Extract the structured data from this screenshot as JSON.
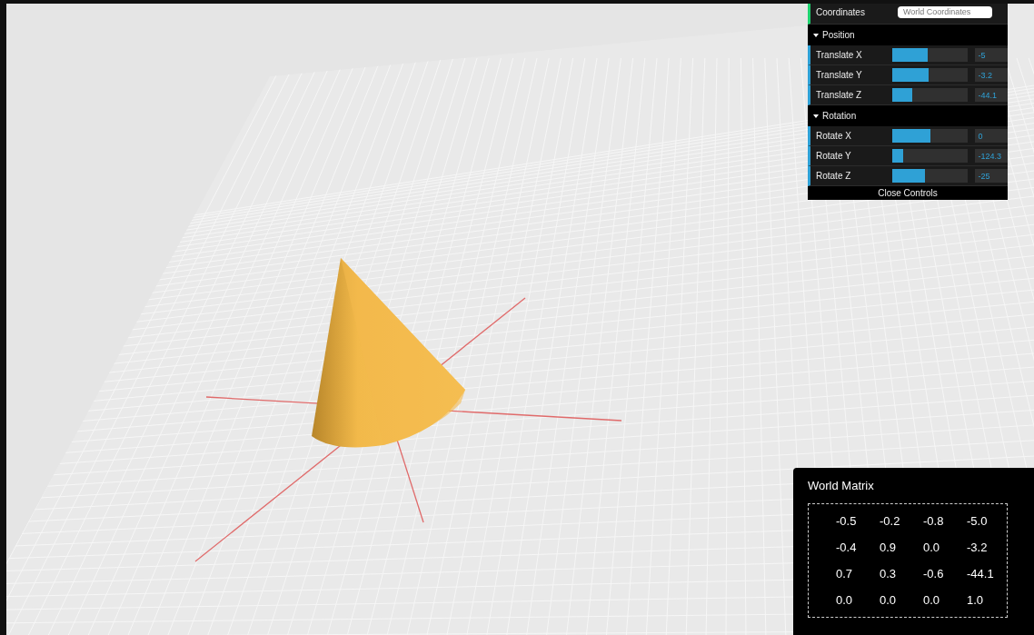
{
  "controls": {
    "coordinates": {
      "label": "Coordinates",
      "value": "World Coordinates"
    },
    "folders": [
      {
        "title": "Position",
        "expanded": true,
        "rows": [
          {
            "label": "Translate X",
            "level": 0.47,
            "value": "-5"
          },
          {
            "label": "Translate Y",
            "level": 0.48,
            "value": "-3.2"
          },
          {
            "label": "Translate Z",
            "level": 0.27,
            "value": "-44.1"
          }
        ]
      },
      {
        "title": "Rotation",
        "expanded": true,
        "rows": [
          {
            "label": "Rotate X",
            "level": 0.5,
            "value": "0"
          },
          {
            "label": "Rotate Y",
            "level": 0.15,
            "value": "-124.3"
          },
          {
            "label": "Rotate Z",
            "level": 0.43,
            "value": "-25"
          }
        ]
      }
    ],
    "close_button": "Close Controls"
  },
  "world_matrix": {
    "title": "World Matrix",
    "rows": [
      [
        "-0.5",
        "-0.2",
        "-0.8",
        "-5.0"
      ],
      [
        "-0.4",
        "0.9",
        "0.0",
        "-3.2"
      ],
      [
        "0.7",
        "0.3",
        "-0.6",
        "-44.1"
      ],
      [
        "0.0",
        "0.0",
        "0.0",
        "1.0"
      ]
    ]
  }
}
